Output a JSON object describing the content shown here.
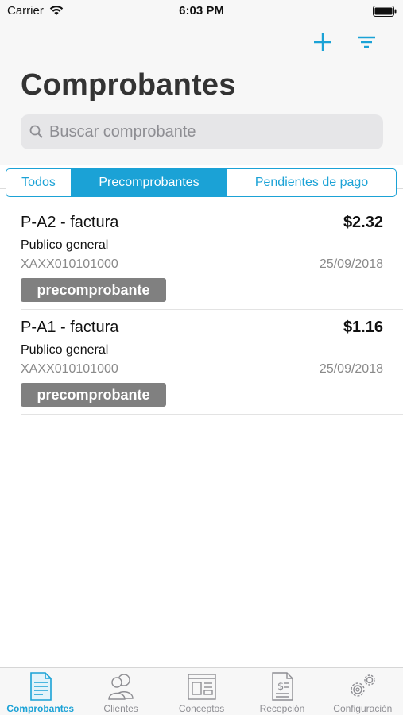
{
  "status_bar": {
    "carrier": "Carrier",
    "time": "6:03 PM"
  },
  "header": {
    "title": "Comprobantes",
    "search_placeholder": "Buscar comprobante",
    "icons": [
      "plus-icon",
      "filter-icon",
      "search-icon"
    ]
  },
  "segments": [
    {
      "label": "Todos",
      "active": false
    },
    {
      "label": "Precomprobantes",
      "active": true
    },
    {
      "label": "Pendientes de pago",
      "active": false
    }
  ],
  "items": [
    {
      "title": "P-A2 - factura",
      "amount": "$2.32",
      "client": "Publico general",
      "rfc": "XAXX010101000",
      "date": "25/09/2018",
      "badge": "precomprobante"
    },
    {
      "title": "P-A1 - factura",
      "amount": "$1.16",
      "client": "Publico general",
      "rfc": "XAXX010101000",
      "date": "25/09/2018",
      "badge": "precomprobante"
    }
  ],
  "tab_bar": {
    "tabs": [
      {
        "label": "Comprobantes",
        "icon": "document-icon",
        "active": true
      },
      {
        "label": "Clientes",
        "icon": "users-icon",
        "active": false
      },
      {
        "label": "Conceptos",
        "icon": "catalog-icon",
        "active": false
      },
      {
        "label": "Recepción",
        "icon": "invoice-icon",
        "active": false
      },
      {
        "label": "Configuración",
        "icon": "gears-icon",
        "active": false
      }
    ]
  },
  "colors": {
    "accent": "#1ba2d6",
    "badge": "#808080",
    "header_bg": "#f7f7f7",
    "search_bg": "#e6e6e8",
    "muted_text": "#8a8a8a"
  }
}
